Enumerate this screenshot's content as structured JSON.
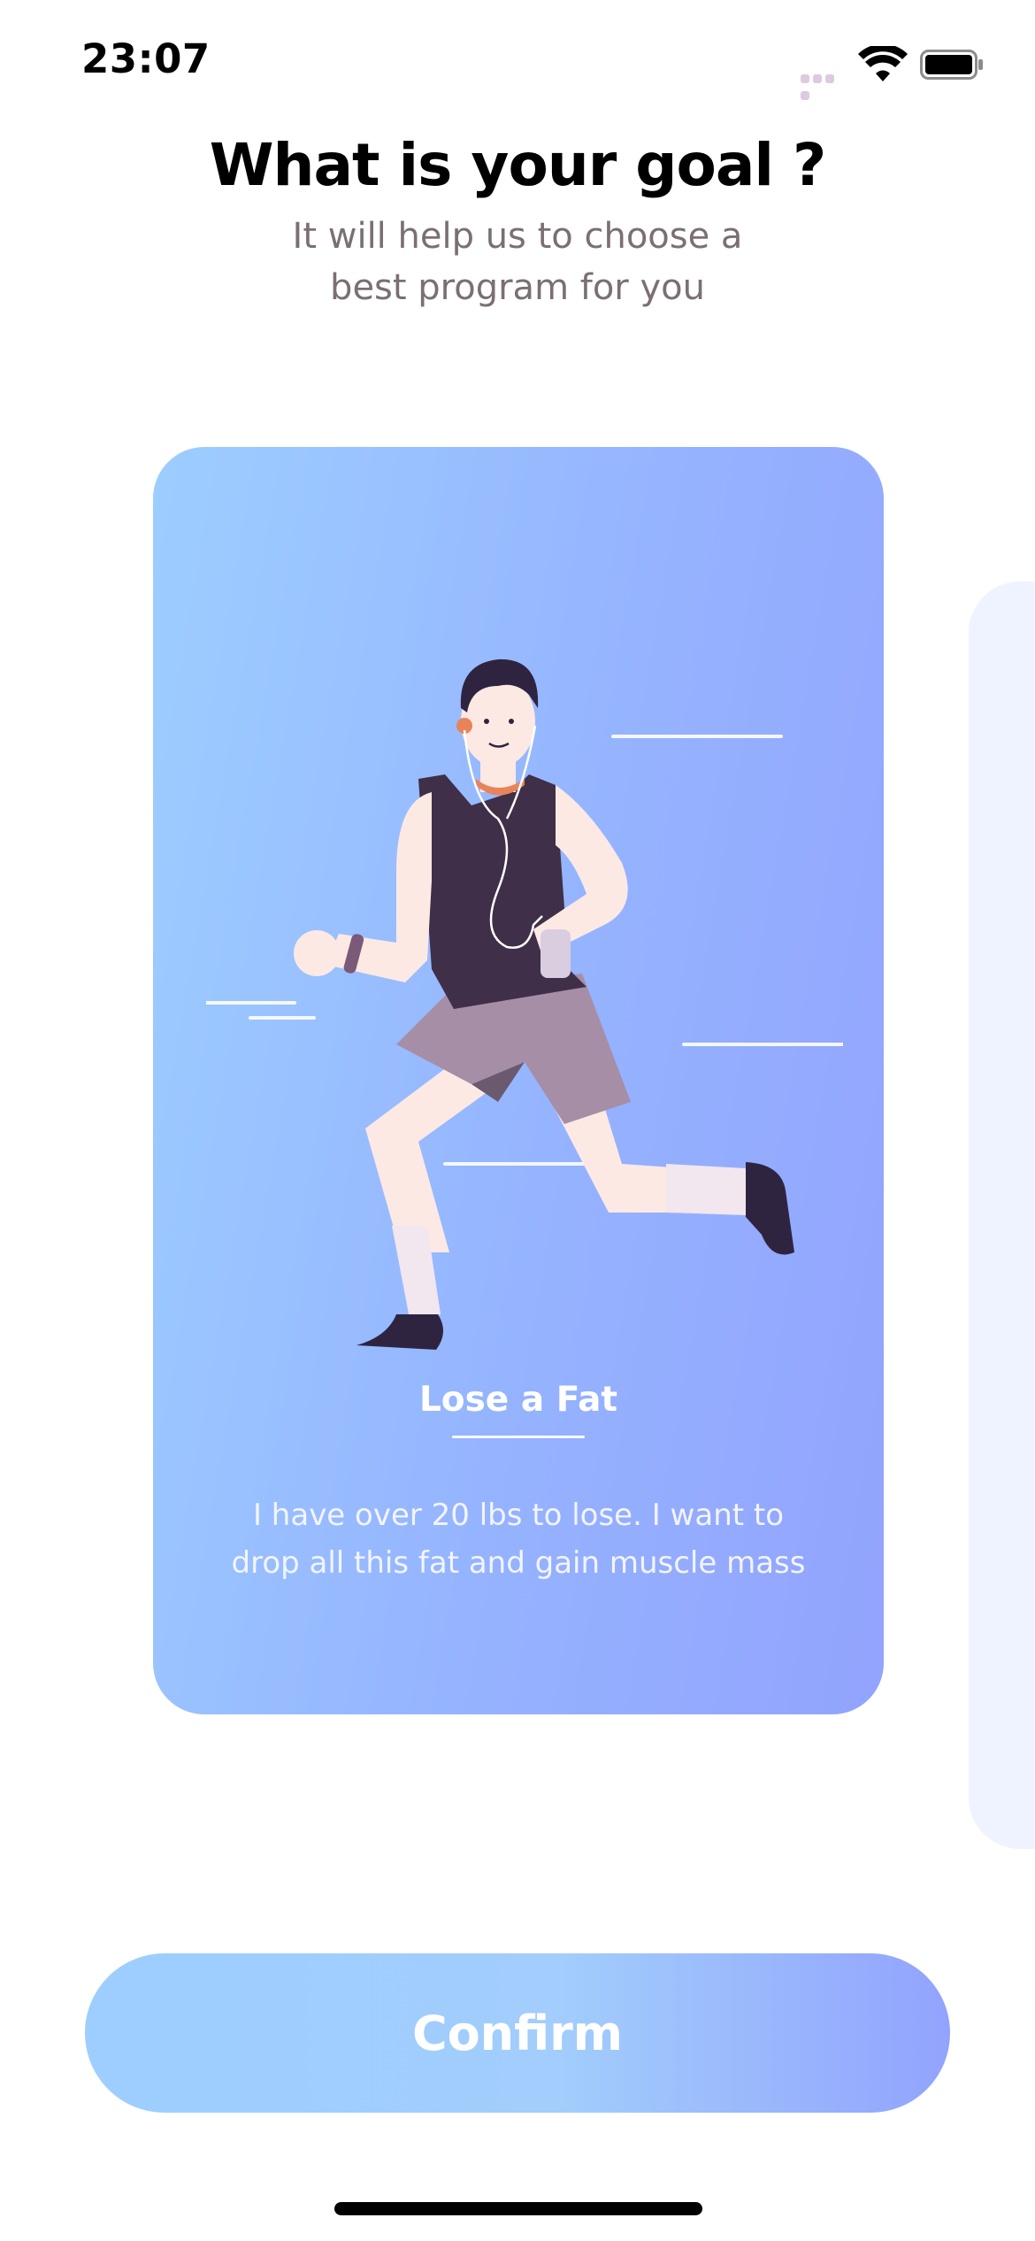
{
  "status_bar": {
    "time": "23:07",
    "icons": [
      "cellular-signal-icon",
      "wifi-icon",
      "battery-icon"
    ]
  },
  "header": {
    "title": "What is your goal ?",
    "subtitle_line1": "It will help us to choose a",
    "subtitle_line2": "best program for you"
  },
  "goal_card": {
    "title": "Lose a Fat",
    "description": "I have over 20 lbs to lose. I want to drop all this fat and gain muscle mass",
    "illustration": "running-man-illustration"
  },
  "confirm_button": {
    "label": "Confirm"
  },
  "colors": {
    "brand_gradient_start": "#9DCEFF",
    "brand_gradient_end": "#92A3FD",
    "title_text": "#000000",
    "subtitle_text": "#7B6F72",
    "next_card_bg": "#EEF3FF"
  }
}
